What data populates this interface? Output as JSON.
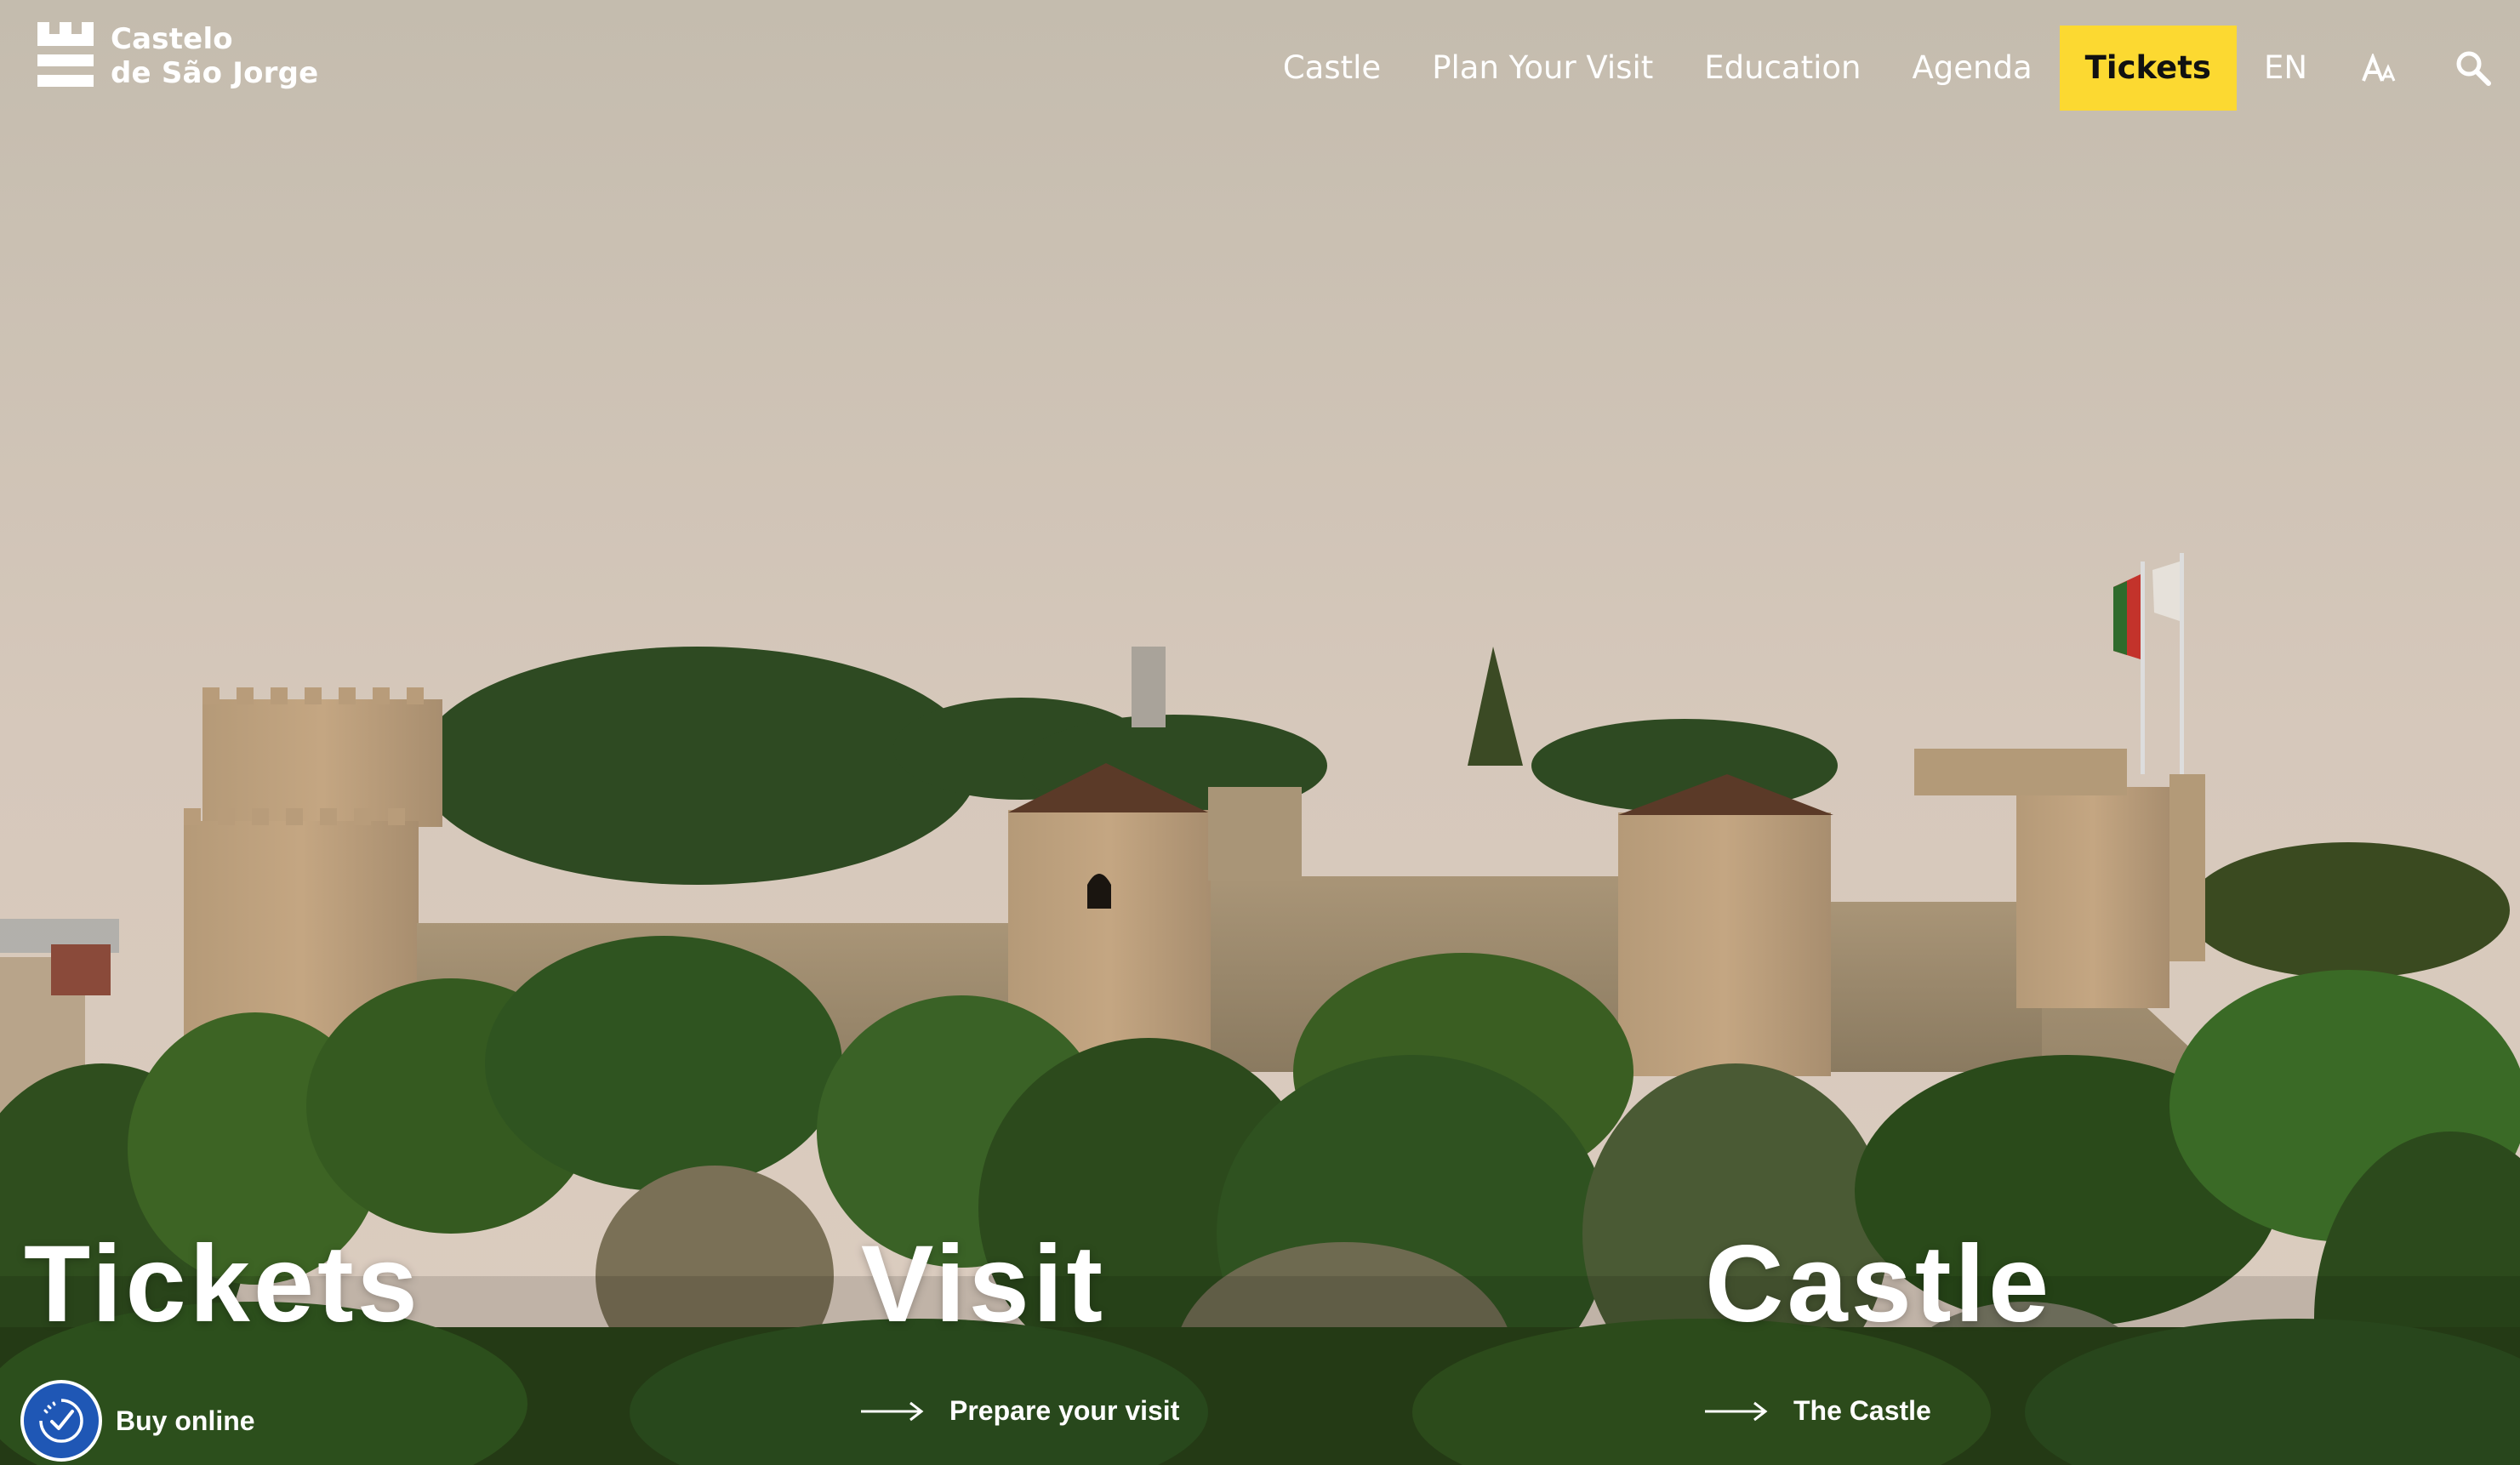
{
  "brand": {
    "line1": "Castelo",
    "line2": "de São Jorge"
  },
  "nav": {
    "items": [
      "Castle",
      "Plan Your Visit",
      "Education",
      "Agenda"
    ],
    "tickets": "Tickets",
    "language": "EN",
    "font_size_icon": "text-size-icon",
    "search_icon": "search-icon"
  },
  "sections": [
    {
      "title": "Tickets",
      "link": "Buy online",
      "icon": "ticket-check-icon"
    },
    {
      "title": "Visit",
      "link": "Prepare your visit",
      "icon": "arrow-right-icon"
    },
    {
      "title": "Castle",
      "link": "The Castle",
      "icon": "arrow-right-icon"
    }
  ],
  "colors": {
    "tickets_bg": "#fcd931",
    "badge_bg": "#1f57b5"
  }
}
